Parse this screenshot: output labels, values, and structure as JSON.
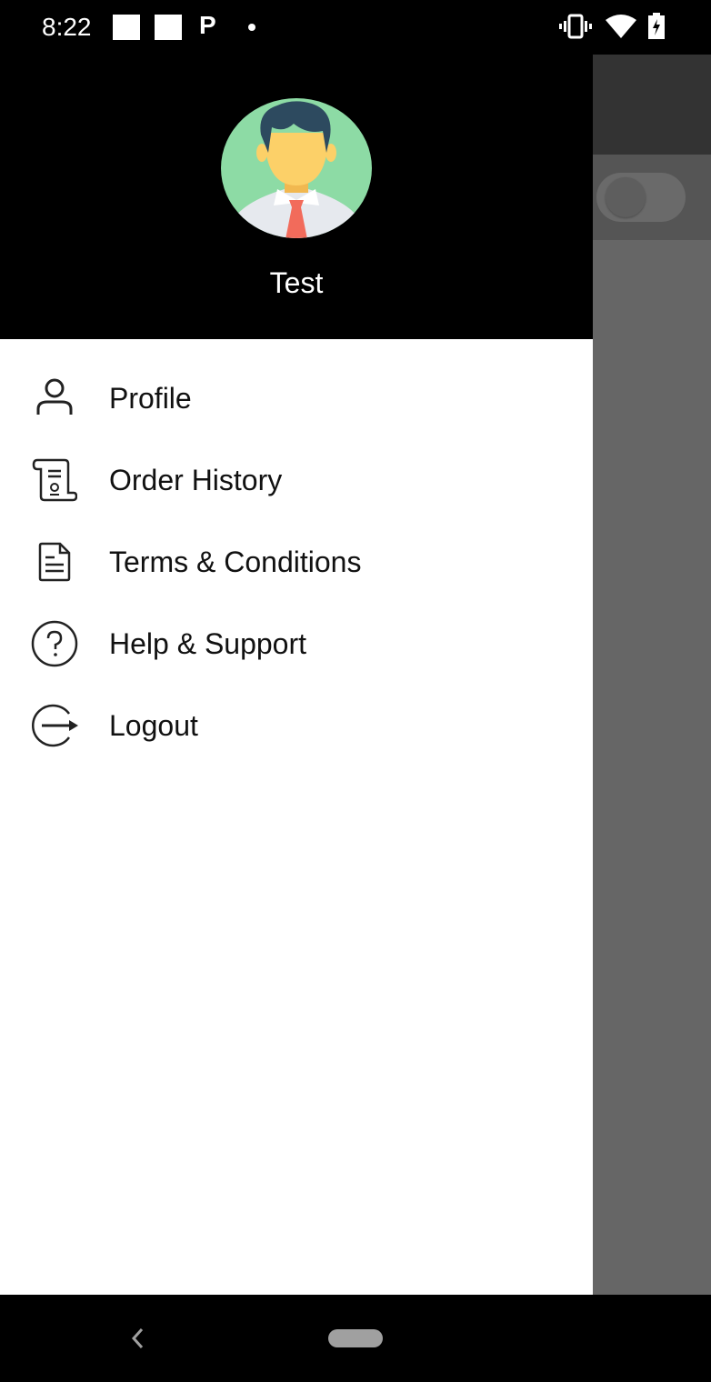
{
  "status_bar": {
    "time": "8:22",
    "notification_icons": [
      "square-notification-icon",
      "square-notification-icon",
      "p-app-icon",
      "more-dot-icon"
    ],
    "p_glyph": "P",
    "system_icons": [
      "vibrate-icon",
      "wifi-icon",
      "battery-charging-icon"
    ]
  },
  "drawer": {
    "user_name": "Test",
    "menu": [
      {
        "label": "Profile",
        "icon": "person-icon"
      },
      {
        "label": "Order History",
        "icon": "scroll-icon"
      },
      {
        "label": "Terms & Conditions",
        "icon": "document-icon"
      },
      {
        "label": "Help & Support",
        "icon": "help-circle-icon"
      },
      {
        "label": "Logout",
        "icon": "logout-icon"
      }
    ]
  },
  "background_app": {
    "toggle_state": "off"
  },
  "colors": {
    "header_bg": "#000000",
    "avatar_bg": "#8DDBA5",
    "tie": "#F26B5B",
    "hair": "#2D4A5F",
    "skin": "#FCD068"
  }
}
